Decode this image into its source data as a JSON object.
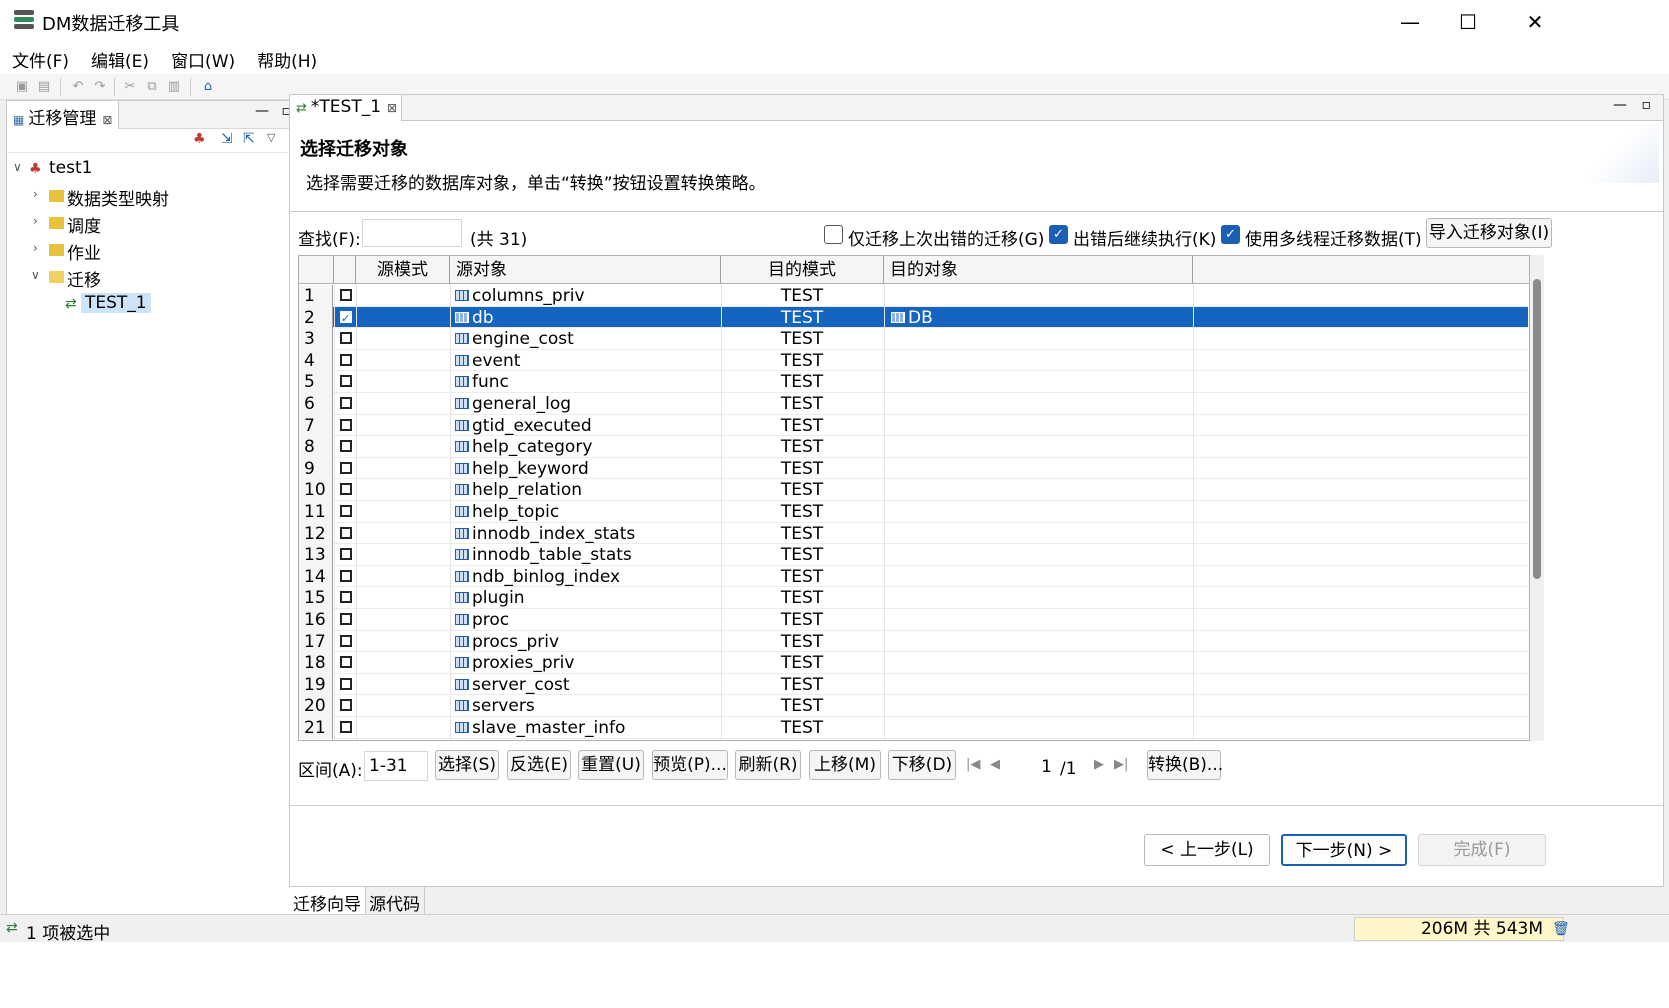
{
  "window": {
    "title": "DM数据迁移工具",
    "minimize": "—",
    "maximize": "☐",
    "close": "✕"
  },
  "menu": [
    "文件(F)",
    "编辑(E)",
    "窗口(W)",
    "帮助(H)"
  ],
  "left_panel": {
    "tab_label": "迁移管理",
    "tree": [
      {
        "label": "test1",
        "level": 0,
        "expanded": true,
        "kind": "project"
      },
      {
        "label": "数据类型映射",
        "level": 1,
        "expanded": false,
        "kind": "folder"
      },
      {
        "label": "调度",
        "level": 1,
        "expanded": false,
        "kind": "folder"
      },
      {
        "label": "作业",
        "level": 1,
        "expanded": false,
        "kind": "folder"
      },
      {
        "label": "迁移",
        "level": 1,
        "expanded": true,
        "kind": "folder"
      },
      {
        "label": "TEST_1",
        "level": 2,
        "expanded": false,
        "kind": "migration",
        "selected": true
      }
    ]
  },
  "editor": {
    "tab_label": "*TEST_1",
    "title": "选择迁移对象",
    "description": "选择需要迁移的数据库对象，单击“转换”按钮设置转换策略。",
    "search_label": "查找(F):",
    "search_value": "",
    "count_label": "(共 31)",
    "options": [
      {
        "label": "仅迁移上次出错的迁移(G)",
        "checked": false
      },
      {
        "label": "出错后继续执行(K)",
        "checked": true
      },
      {
        "label": "使用多线程迁移数据(T)",
        "checked": true
      }
    ],
    "import_button": "导入迁移对象(I)",
    "columns": [
      "源模式",
      "源对象",
      "目的模式",
      "目的对象"
    ],
    "rows": [
      {
        "n": "1",
        "src": "columns_priv",
        "tm": "TEST",
        "to": "",
        "checked": false
      },
      {
        "n": "2",
        "src": "db",
        "tm": "TEST",
        "to": "DB",
        "checked": true
      },
      {
        "n": "3",
        "src": "engine_cost",
        "tm": "TEST",
        "to": "",
        "checked": false
      },
      {
        "n": "4",
        "src": "event",
        "tm": "TEST",
        "to": "",
        "checked": false
      },
      {
        "n": "5",
        "src": "func",
        "tm": "TEST",
        "to": "",
        "checked": false
      },
      {
        "n": "6",
        "src": "general_log",
        "tm": "TEST",
        "to": "",
        "checked": false
      },
      {
        "n": "7",
        "src": "gtid_executed",
        "tm": "TEST",
        "to": "",
        "checked": false
      },
      {
        "n": "8",
        "src": "help_category",
        "tm": "TEST",
        "to": "",
        "checked": false
      },
      {
        "n": "9",
        "src": "help_keyword",
        "tm": "TEST",
        "to": "",
        "checked": false
      },
      {
        "n": "10",
        "src": "help_relation",
        "tm": "TEST",
        "to": "",
        "checked": false
      },
      {
        "n": "11",
        "src": "help_topic",
        "tm": "TEST",
        "to": "",
        "checked": false
      },
      {
        "n": "12",
        "src": "innodb_index_stats",
        "tm": "TEST",
        "to": "",
        "checked": false
      },
      {
        "n": "13",
        "src": "innodb_table_stats",
        "tm": "TEST",
        "to": "",
        "checked": false
      },
      {
        "n": "14",
        "src": "ndb_binlog_index",
        "tm": "TEST",
        "to": "",
        "checked": false
      },
      {
        "n": "15",
        "src": "plugin",
        "tm": "TEST",
        "to": "",
        "checked": false
      },
      {
        "n": "16",
        "src": "proc",
        "tm": "TEST",
        "to": "",
        "checked": false
      },
      {
        "n": "17",
        "src": "procs_priv",
        "tm": "TEST",
        "to": "",
        "checked": false
      },
      {
        "n": "18",
        "src": "proxies_priv",
        "tm": "TEST",
        "to": "",
        "checked": false
      },
      {
        "n": "19",
        "src": "server_cost",
        "tm": "TEST",
        "to": "",
        "checked": false
      },
      {
        "n": "20",
        "src": "servers",
        "tm": "TEST",
        "to": "",
        "checked": false
      },
      {
        "n": "21",
        "src": "slave_master_info",
        "tm": "TEST",
        "to": "",
        "checked": false
      }
    ],
    "range_label": "区间(A):",
    "range_value": "1-31",
    "action_buttons": [
      "选择(S)",
      "反选(E)",
      "重置(U)",
      "预览(P)...",
      "刷新(R)",
      "上移(M)",
      "下移(D)"
    ],
    "page_current": "1",
    "page_total": "/1",
    "convert_button": "转换(B)...",
    "wizard_buttons": {
      "prev": "< 上一步(L)",
      "next": "下一步(N) >",
      "finish": "完成(F)"
    }
  },
  "bottom_tabs": [
    "迁移向导",
    "源代码"
  ],
  "status": {
    "text": "1 项被选中",
    "memory": "206M 共 543M"
  }
}
